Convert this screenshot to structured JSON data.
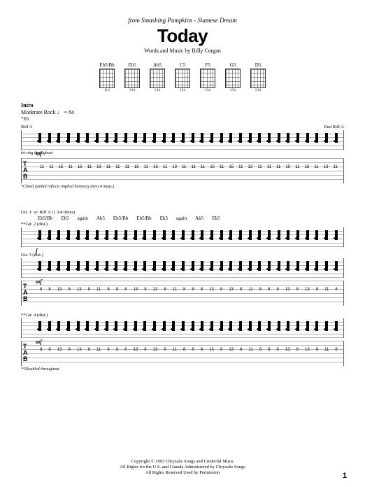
{
  "header": {
    "from_line": "from Smashing Pumpkins  - Siamese Dream",
    "title": "Today",
    "byline": "Words and Music by Billy Corgan"
  },
  "chords": [
    {
      "name": "Eb5/Bb",
      "fingers": "113"
    },
    {
      "name": "Eb5",
      "fingers": "134"
    },
    {
      "name": "Ab5",
      "fingers": "134"
    },
    {
      "name": "C5",
      "fingers": "134"
    },
    {
      "name": "F5",
      "fingers": "134"
    },
    {
      "name": "G5",
      "fingers": "134"
    },
    {
      "name": "D5",
      "fingers": "134"
    }
  ],
  "intro": {
    "section": "Intro",
    "tempo": "Moderate Rock ♩ = 84",
    "tune_note": "*Eb",
    "riff_a": "Riff A",
    "end_riff": "End Riff A",
    "dynamic": "mf",
    "let_ring": "let ring throughout",
    "tab_values": [
      "11",
      "11",
      "15",
      "11",
      "15",
      "11",
      "13",
      "11",
      "11",
      "11",
      "15",
      "11",
      "15",
      "11",
      "13",
      "11",
      "11",
      "11",
      "15",
      "11",
      "15",
      "11",
      "13",
      "11",
      "11",
      "11",
      "15",
      "11",
      "15",
      "11",
      "13",
      "11"
    ],
    "footnote": "*Chord symbol reflects implied harmony (next 4 meas.)"
  },
  "system2": {
    "repeat_note": "Gtr. 1: w/ Riff A (1 3/4 times)",
    "chord_seq": [
      "Eb5/Bb",
      "Eb5",
      "again",
      "Ab5",
      "Eb5/Bb",
      "Eb5/Bb",
      "Eb5",
      "again",
      "Ab5",
      "Eb5"
    ],
    "gtr2_label": "**Gtr. 2 (dist.)",
    "gtr3_label": "Gtr. 3 (dist.)",
    "dynamic_f": "f",
    "dynamic_mf": "mf",
    "gtr4_label": "**Gtr. 4 (dist.)",
    "tab3": [
      "8",
      "8",
      "13",
      "8",
      "13",
      "8",
      "11",
      "8",
      "8",
      "8",
      "13",
      "8",
      "13",
      "8",
      "11",
      "8",
      "8",
      "8",
      "13",
      "8",
      "13",
      "8",
      "11",
      "8",
      "8",
      "8",
      "13",
      "8",
      "13",
      "8",
      "11",
      "8"
    ],
    "footnote2": "**Doubled throughout"
  },
  "footer": {
    "c1": "Copyright © 1993 Chrysalis Songs and Cinderful Music",
    "c2": "All Rights for the U.S. and Canada Administered by Chrysalis Songs",
    "c3": "All Rights Reserved   Used by Permission",
    "page": "1"
  }
}
